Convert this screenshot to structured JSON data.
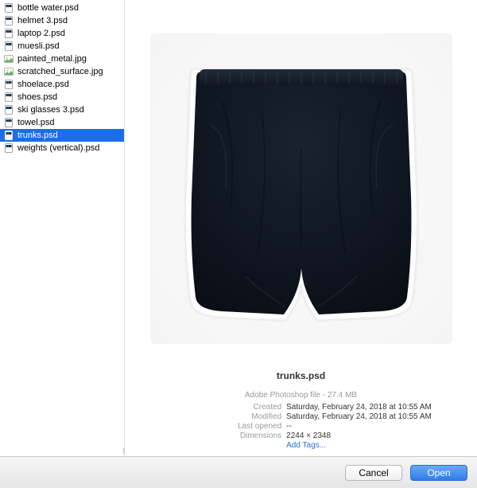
{
  "files": [
    {
      "name": "bottle water.psd",
      "type": "psd",
      "selected": false
    },
    {
      "name": "helmet 3.psd",
      "type": "psd",
      "selected": false
    },
    {
      "name": "laptop 2.psd",
      "type": "psd",
      "selected": false
    },
    {
      "name": "muesli.psd",
      "type": "psd",
      "selected": false
    },
    {
      "name": "painted_metal.jpg",
      "type": "jpg",
      "selected": false
    },
    {
      "name": "scratched_surface.jpg",
      "type": "jpg",
      "selected": false
    },
    {
      "name": "shoelace.psd",
      "type": "psd",
      "selected": false
    },
    {
      "name": "shoes.psd",
      "type": "psd",
      "selected": false
    },
    {
      "name": "ski glasses 3.psd",
      "type": "psd",
      "selected": false
    },
    {
      "name": "towel.psd",
      "type": "psd",
      "selected": false
    },
    {
      "name": "trunks.psd",
      "type": "psd",
      "selected": true
    },
    {
      "name": "weights (vertical).psd",
      "type": "psd",
      "selected": false
    }
  ],
  "preview": {
    "filename": "trunks.psd",
    "kind_size": "Adobe Photoshop file - 27.4 MB",
    "labels": {
      "created": "Created",
      "modified": "Modified",
      "last_opened": "Last opened",
      "dimensions": "Dimensions"
    },
    "values": {
      "created": "Saturday, February 24, 2018 at 10:55 AM",
      "modified": "Saturday, February 24, 2018 at 10:55 AM",
      "last_opened": "--",
      "dimensions": "2244 × 2348"
    },
    "add_tags": "Add Tags..."
  },
  "footer": {
    "cancel": "Cancel",
    "open": "Open"
  }
}
